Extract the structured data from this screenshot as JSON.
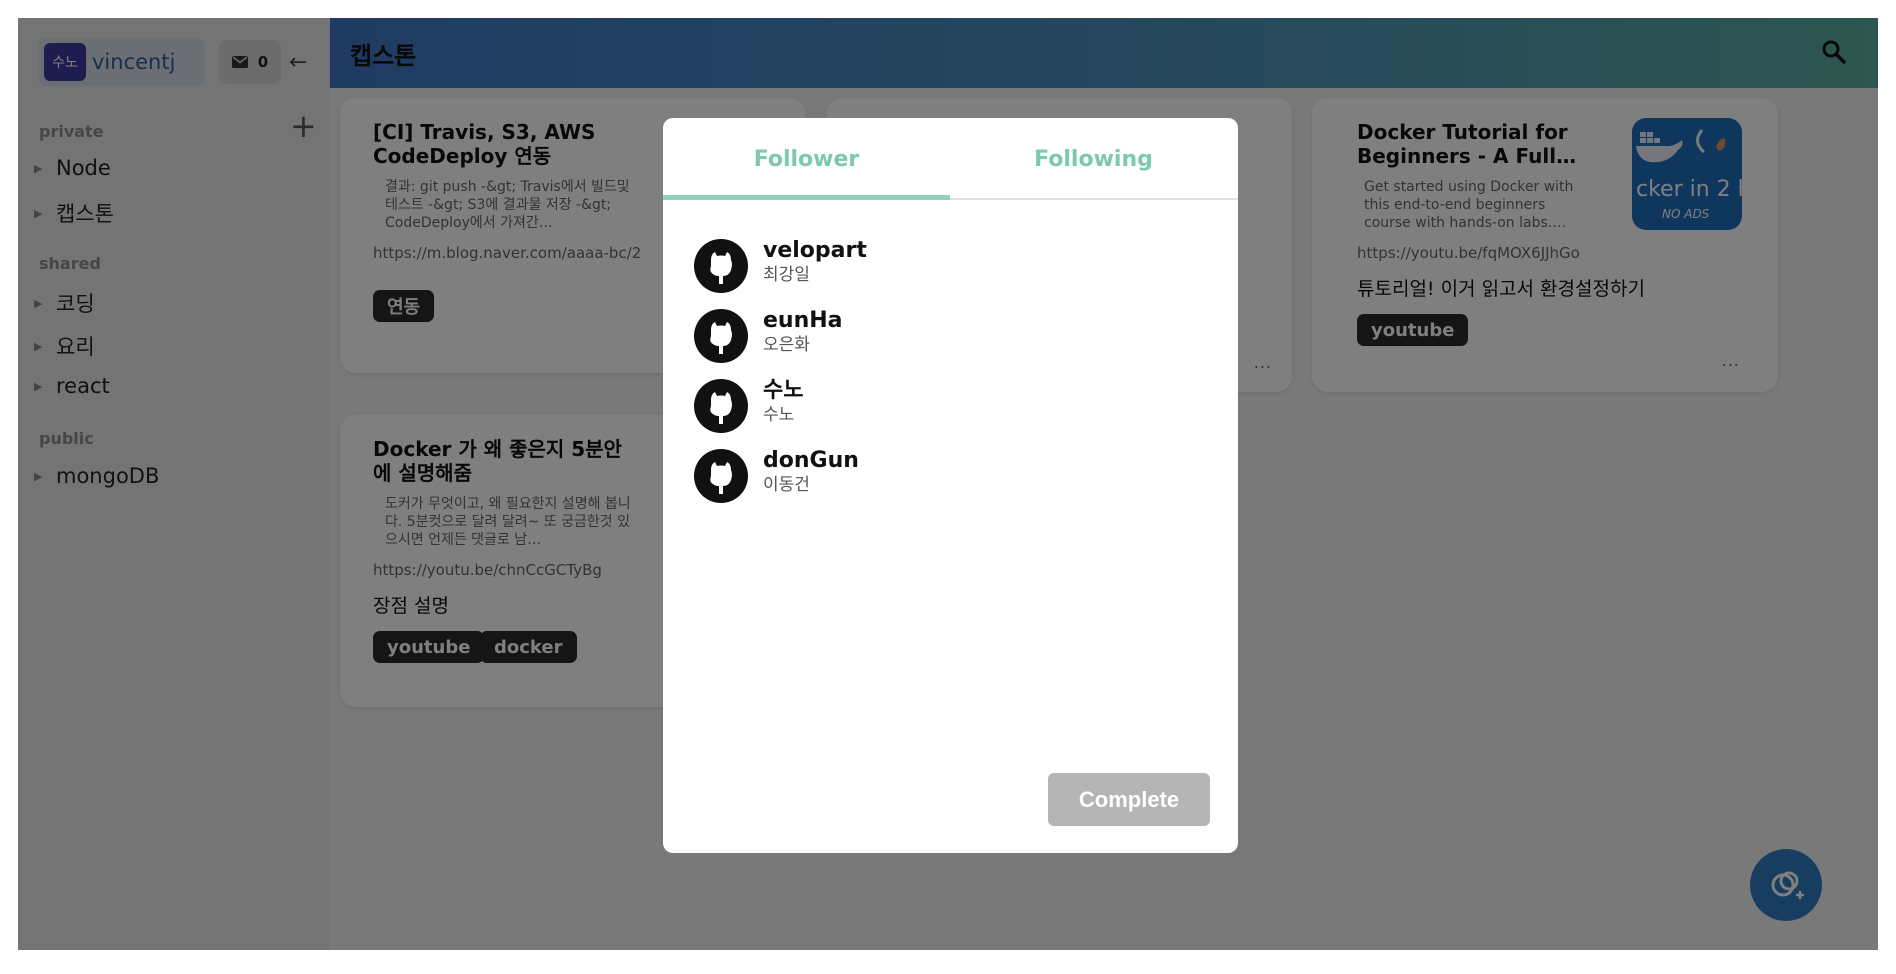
{
  "sidebar": {
    "avatar_text": "수노",
    "username": "vincentj",
    "mail_count": "0",
    "add_label": "+",
    "sections": [
      {
        "label": "private",
        "items": [
          "Node",
          "캡스톤"
        ]
      },
      {
        "label": "shared",
        "items": [
          "코딩",
          "요리",
          "react"
        ]
      },
      {
        "label": "public",
        "items": [
          "mongoDB"
        ]
      }
    ]
  },
  "header": {
    "title": "캡스톤"
  },
  "cards": [
    {
      "title": "[CI] Travis, S3, AWS CodeDeploy 연동",
      "desc": "결과: git push -&gt; Travis에서 빌드및 테스트 -&gt; S3에 결과물 저장 -&gt; CodeDeploy에서 가져간…",
      "url": "https://m.blog.naver.com/aaaa-bc/2",
      "memo": "",
      "tags": [
        "연동"
      ]
    },
    {
      "title": "Docker 가 왜 좋은지 5분안에 설명해줌",
      "desc": "도커가 무엇이고, 왜 필요한지 설명해 봅니다. 5분컷으로 달려 달려~ 또 궁금한것 있으시면 언제든 댓글로 남…",
      "url": "https://youtu.be/chnCcGCTyBg",
      "memo": "장점 설명",
      "tags": [
        "youtube",
        "docker"
      ]
    },
    {
      "title": "Docker Tutorial for Beginners - A Full…",
      "desc": "Get started using Docker with this end-to-end beginners course with hands-on labs.…",
      "url": "https://youtu.be/fqMOX6JJhGo",
      "memo": "튜토리얼! 이거 읽고서 환경설정하기",
      "tags": [
        "youtube"
      ],
      "thumb_text": "cker in 2 h",
      "thumb_sub": "NO ADS"
    }
  ],
  "card_more": "...",
  "modal": {
    "tabs": [
      "Follower",
      "Following"
    ],
    "users": [
      {
        "id": "velopart",
        "name": "최강일"
      },
      {
        "id": "eunHa",
        "name": "오은화"
      },
      {
        "id": "수노",
        "name": "수노"
      },
      {
        "id": "donGun",
        "name": "이동건"
      }
    ],
    "complete_label": "Complete"
  },
  "colors": {
    "accent": "#7dc8b0",
    "header_start": "#3f76c6",
    "header_end": "#5aac9f",
    "fab": "#2f7bc2"
  }
}
